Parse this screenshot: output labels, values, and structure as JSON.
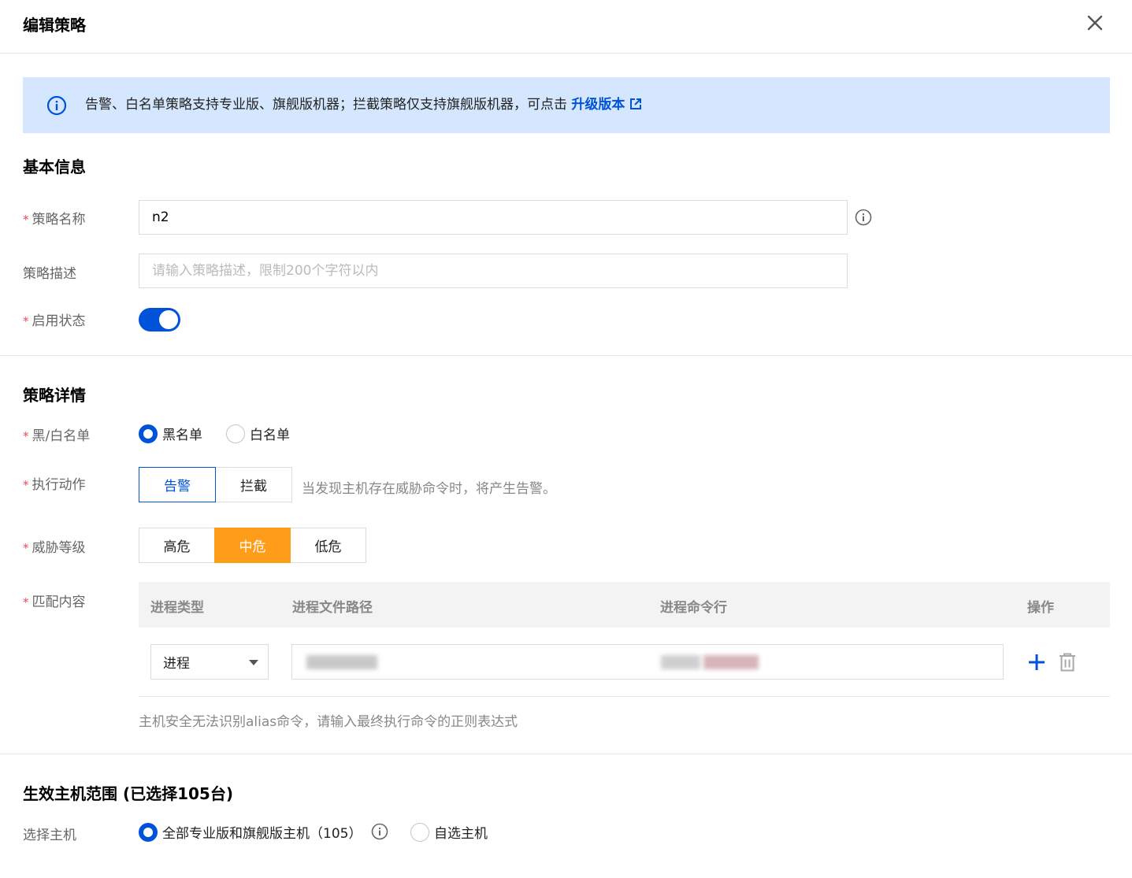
{
  "dialog": {
    "title": "编辑策略"
  },
  "alert": {
    "text": "告警、白名单策略支持专业版、旗舰版机器；拦截策略仅支持旗舰版机器，可点击",
    "link": "升级版本"
  },
  "basic": {
    "title": "基本信息",
    "name_label": "策略名称",
    "name_value": "n2",
    "desc_label": "策略描述",
    "desc_placeholder": "请输入策略描述，限制200个字符以内",
    "status_label": "启用状态",
    "status_on": true
  },
  "detail": {
    "title": "策略详情",
    "list_label": "黑/白名单",
    "list_options": [
      "黑名单",
      "白名单"
    ],
    "list_selected": "黑名单",
    "action_label": "执行动作",
    "actions": [
      "告警",
      "拦截"
    ],
    "action_selected": "告警",
    "action_hint": "当发现主机存在威胁命令时，将产生告警。",
    "level_label": "威胁等级",
    "levels": [
      "高危",
      "中危",
      "低危"
    ],
    "level_selected": "中危",
    "match_label": "匹配内容",
    "table_headers": [
      "进程类型",
      "进程文件路径",
      "进程命令行",
      "操作"
    ],
    "row_process_type": "进程",
    "match_hint": "主机安全无法识别alias命令，请输入最终执行命令的正则表达式"
  },
  "scope": {
    "title": "生效主机范围 (已选择105台)",
    "label": "选择主机",
    "options": [
      "全部专业版和旗舰版主机（105）",
      "自选主机"
    ],
    "selected": "全部专业版和旗舰版主机（105）"
  },
  "colors": {
    "primary": "#0052d9",
    "warning": "#ff9c19",
    "alert_bg": "#d5e7fe",
    "required": "#e34d59"
  },
  "icons": {
    "close": "close-icon",
    "info": "info-circle-icon",
    "external": "external-link-icon",
    "add": "plus-icon",
    "delete": "trash-icon",
    "dropdown": "caret-down-icon"
  }
}
